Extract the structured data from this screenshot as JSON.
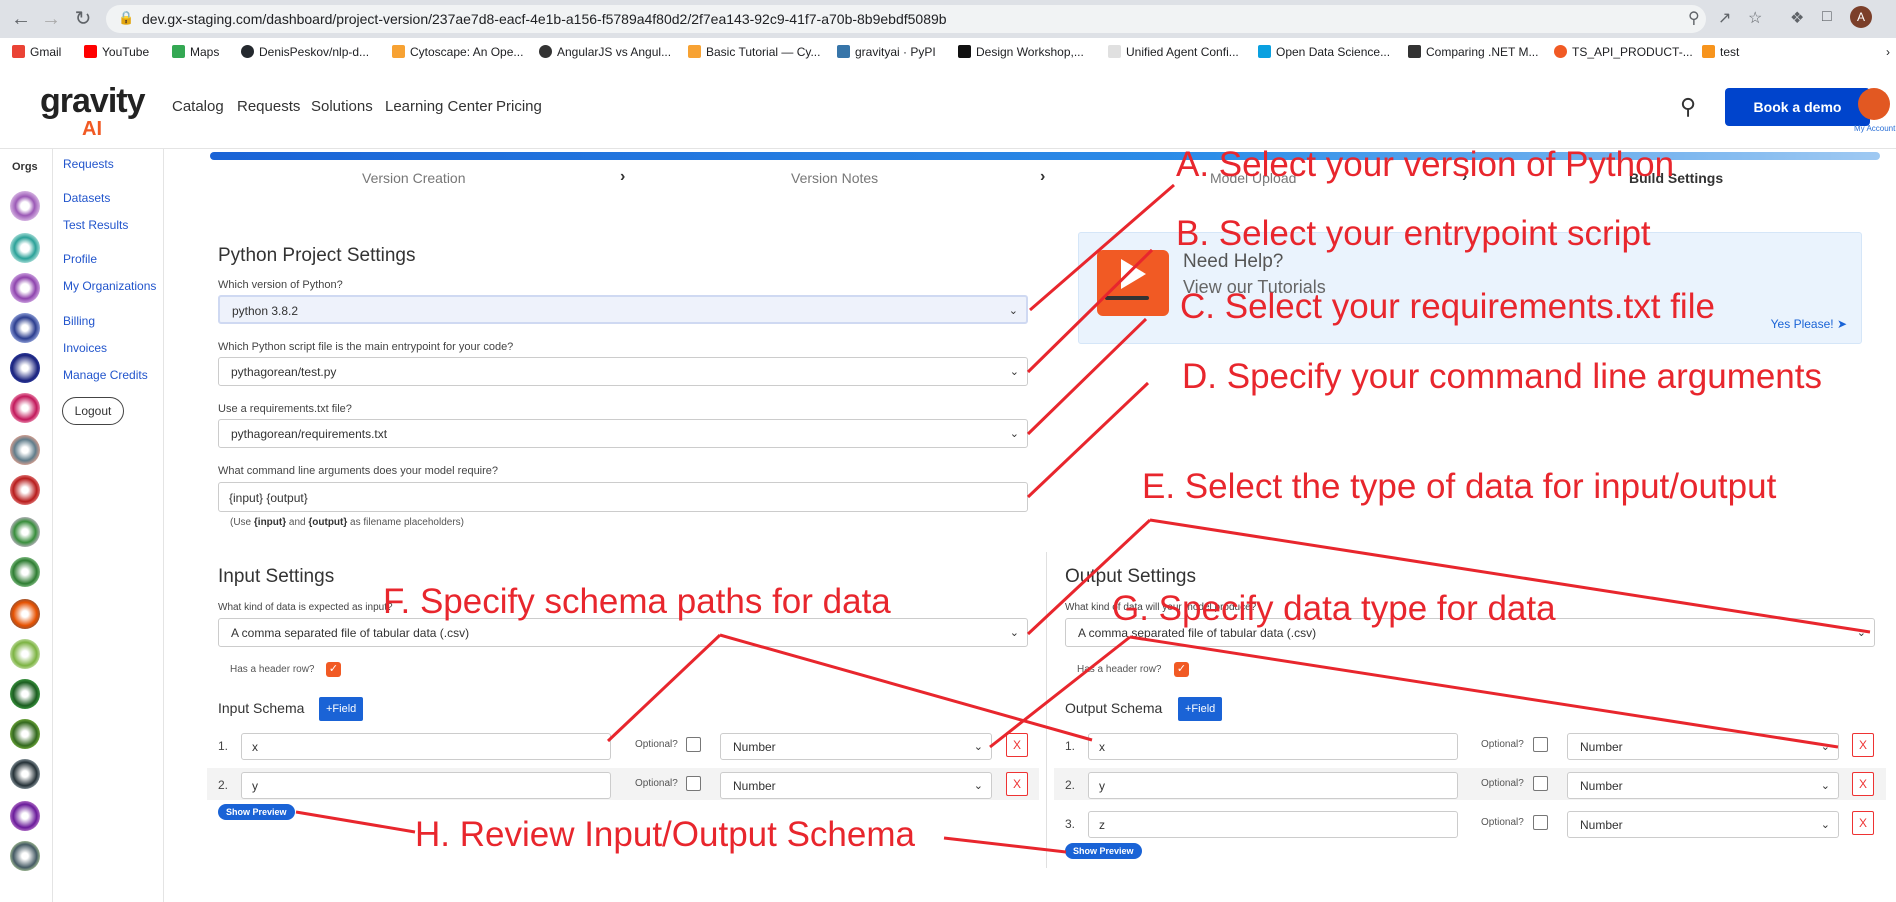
{
  "browser": {
    "url": "dev.gx-staging.com/dashboard/project-version/237ae7d8-eacf-4e1b-a156-f5789a4f80d2/2f7ea143-92c9-41f7-a70b-8b9ebdf5089b",
    "profile_letter": "A",
    "bookmarks": [
      "Gmail",
      "YouTube",
      "Maps",
      "DenisPeskov/nlp-d...",
      "Cytoscape: An Ope...",
      "AngularJS vs Angul...",
      "Basic Tutorial — Cy...",
      "gravityai · PyPI",
      "Design Workshop,...",
      "Unified Agent Confi...",
      "Open Data Science...",
      "Comparing .NET M...",
      "TS_API_PRODUCT-...",
      "test"
    ]
  },
  "app": {
    "logo_main": "gravity",
    "logo_sub": "AI",
    "nav": [
      "Catalog",
      "Requests",
      "Solutions",
      "Learning Center",
      "Pricing"
    ],
    "book_demo": "Book a demo",
    "account_label": "My Account",
    "orgs_label": "Orgs"
  },
  "menu": {
    "items": [
      "Requests",
      "Datasets",
      "Test Results",
      "Profile",
      "My Organizations",
      "Billing",
      "Invoices",
      "Manage Credits"
    ],
    "logout": "Logout"
  },
  "steps": [
    "Version Creation",
    "Version Notes",
    "Model Upload",
    "Build Settings"
  ],
  "python": {
    "title": "Python Project Settings",
    "version_label": "Which version of Python?",
    "version_value": "python 3.8.2",
    "entry_label": "Which Python script file is the main entrypoint for your code?",
    "entry_value": "pythagorean/test.py",
    "req_label": "Use a requirements.txt file?",
    "req_value": "pythagorean/requirements.txt",
    "args_label": "What command line arguments does your model require?",
    "args_value": "{input} {output}",
    "hint_pre": "(Use ",
    "hint_input": "{input}",
    "hint_mid": " and ",
    "hint_output": "{output}",
    "hint_post": " as filename placeholders)"
  },
  "help": {
    "title": "Need Help?",
    "subtitle": "View our Tutorials",
    "link": "Yes Please!"
  },
  "input": {
    "title": "Input Settings",
    "kind_label": "What kind of data is expected as input?",
    "kind_value": "A comma separated file of tabular data (.csv)",
    "header_label": "Has a header row?",
    "schema_title": "Input Schema",
    "add_field": "+Field",
    "optional_label": "Optional?",
    "remove": "X",
    "rows": [
      {
        "num": "1.",
        "name": "x",
        "type": "Number"
      },
      {
        "num": "2.",
        "name": "y",
        "type": "Number"
      }
    ],
    "preview": "Show Preview"
  },
  "output": {
    "title": "Output Settings",
    "kind_label": "What kind of data will your model produce?",
    "kind_value": "A comma separated file of tabular data (.csv)",
    "header_label": "Has a header row?",
    "schema_title": "Output Schema",
    "add_field": "+Field",
    "optional_label": "Optional?",
    "remove": "X",
    "rows": [
      {
        "num": "1.",
        "name": "x",
        "type": "Number"
      },
      {
        "num": "2.",
        "name": "y",
        "type": "Number"
      },
      {
        "num": "3.",
        "name": "z",
        "type": "Number"
      }
    ],
    "preview": "Show Preview"
  },
  "annotations": {
    "a": "A. Select your version of Python",
    "b": "B. Select your entrypoint script",
    "c": "C. Select your requirements.txt file",
    "d": "D. Specify your command line arguments",
    "e": "E. Select the type of data for input/output",
    "f": "F. Specify  schema paths for data",
    "g": "G. Specify data type for data",
    "h": "H. Review Input/Output Schema"
  },
  "colors": {
    "accent": "#1a63d6",
    "brand_orange": "#f15a24",
    "annotation_red": "#e8262d"
  }
}
